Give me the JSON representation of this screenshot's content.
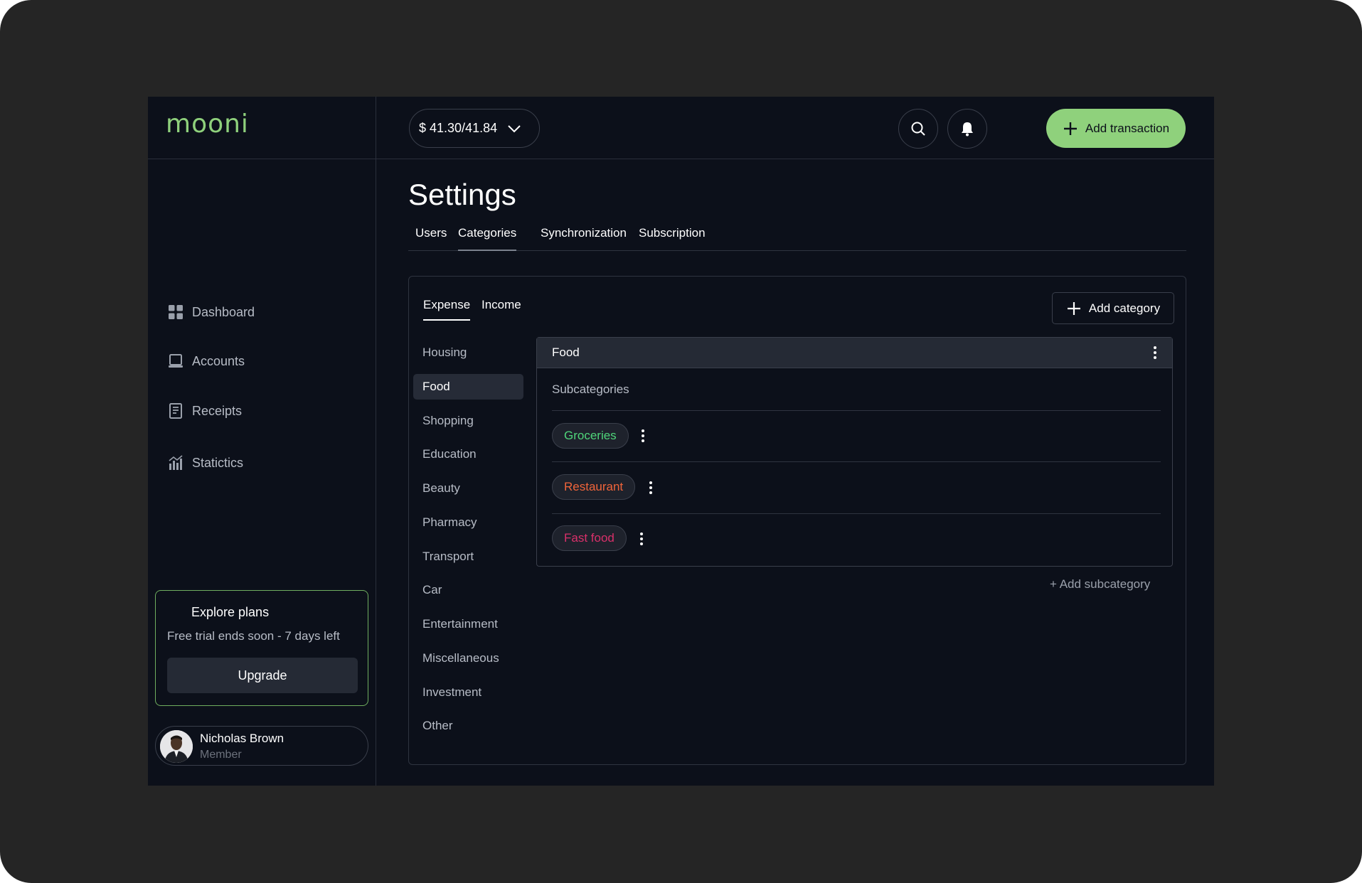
{
  "app": {
    "logo": "mooni"
  },
  "sidebar": {
    "items": [
      {
        "label": "Dashboard",
        "icon": "grid-icon"
      },
      {
        "label": "Accounts",
        "icon": "laptop-icon"
      },
      {
        "label": "Receipts",
        "icon": "receipt-icon"
      },
      {
        "label": "Statictics",
        "icon": "bar-chart-icon"
      }
    ],
    "plan": {
      "title": "Explore plans",
      "text": "Free trial ends soon - 7 days left",
      "button": "Upgrade"
    },
    "user": {
      "name": "Nicholas Brown",
      "role": "Member"
    }
  },
  "header": {
    "balance": "$ 41.30/41.84",
    "add_transaction": "Add transaction"
  },
  "page": {
    "title": "Settings",
    "tabs": [
      "Users",
      "Categories",
      "Synchronization",
      "Subscription"
    ],
    "active_tab": "Categories"
  },
  "categories": {
    "type_tabs": [
      "Expense",
      "Income"
    ],
    "active_type": "Expense",
    "add_button": "Add category",
    "list": [
      "Housing",
      "Food",
      "Shopping",
      "Education",
      "Beauty",
      "Pharmacy",
      "Transport",
      "Car",
      "Entertainment",
      "Miscellaneous",
      "Investment",
      "Other"
    ],
    "selected": "Food"
  },
  "detail": {
    "title": "Food",
    "subcategories_label": "Subcategories",
    "subcategories": [
      {
        "label": "Groceries",
        "color": "#4fd67a"
      },
      {
        "label": "Restaurant",
        "color": "#f0643a"
      },
      {
        "label": "Fast food",
        "color": "#d9306a"
      }
    ],
    "add_subcategory": "+ Add subcategory"
  },
  "colors": {
    "accent": "#8fd17c",
    "background": "#0c101a",
    "frame": "#252525"
  }
}
